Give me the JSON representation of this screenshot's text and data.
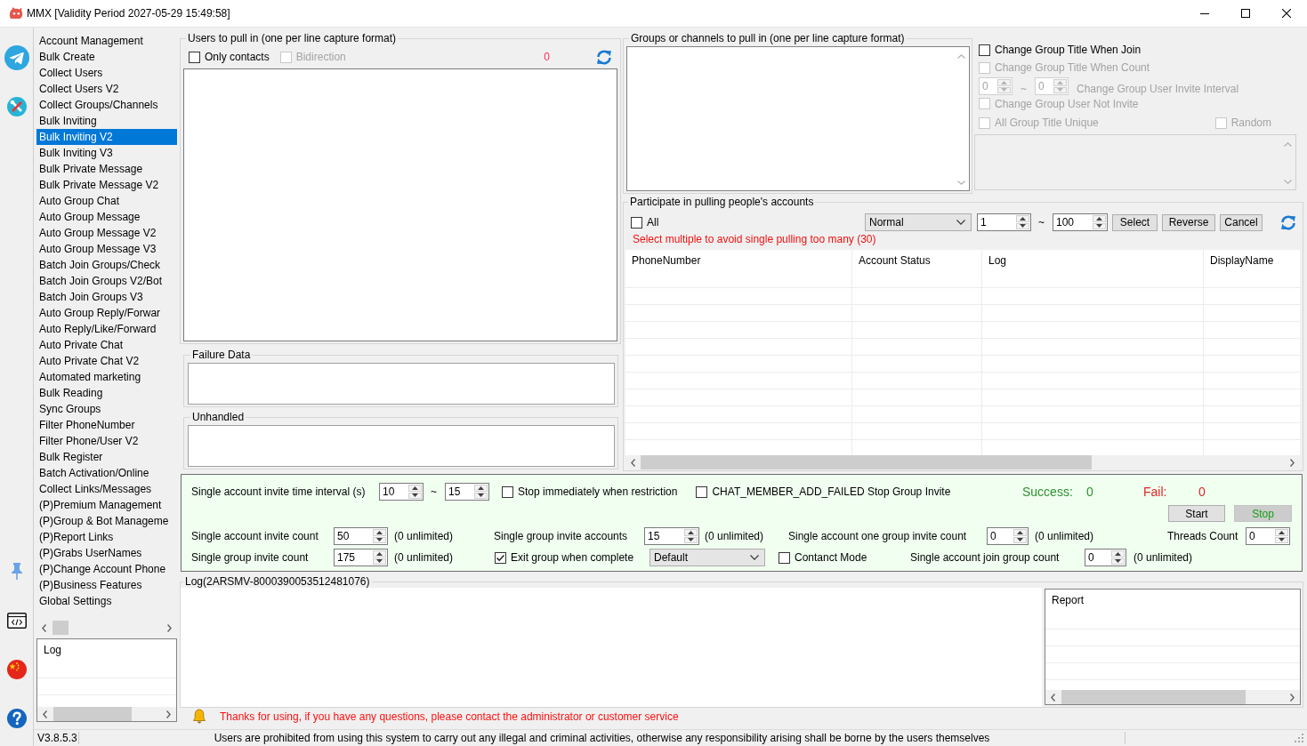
{
  "window": {
    "title": "MMX [Validity Period 2027-05-29 15:49:58]"
  },
  "sidebar": {
    "items": [
      {
        "label": "Account Management",
        "selected": false
      },
      {
        "label": "Bulk Create",
        "selected": false
      },
      {
        "label": "Collect Users",
        "selected": false
      },
      {
        "label": "Collect Users V2",
        "selected": false
      },
      {
        "label": "Collect Groups/Channels",
        "selected": false
      },
      {
        "label": "Bulk Inviting",
        "selected": false
      },
      {
        "label": "Bulk Inviting V2",
        "selected": true
      },
      {
        "label": "Bulk Inviting V3",
        "selected": false
      },
      {
        "label": "Bulk Private Message",
        "selected": false
      },
      {
        "label": "Bulk Private Message V2",
        "selected": false
      },
      {
        "label": "Auto Group Chat",
        "selected": false
      },
      {
        "label": "Auto Group Message",
        "selected": false
      },
      {
        "label": "Auto Group Message V2",
        "selected": false
      },
      {
        "label": "Auto Group Message V3",
        "selected": false
      },
      {
        "label": "Batch Join Groups/Check",
        "selected": false
      },
      {
        "label": "Batch Join Groups V2/Bot",
        "selected": false
      },
      {
        "label": "Batch Join Groups V3",
        "selected": false
      },
      {
        "label": "Auto Group Reply/Forwar",
        "selected": false
      },
      {
        "label": "Auto Reply/Like/Forward",
        "selected": false
      },
      {
        "label": "Auto Private Chat",
        "selected": false
      },
      {
        "label": "Auto Private Chat V2",
        "selected": false
      },
      {
        "label": "Automated marketing",
        "selected": false
      },
      {
        "label": "Bulk Reading",
        "selected": false
      },
      {
        "label": "Sync Groups",
        "selected": false
      },
      {
        "label": "Filter PhoneNumber",
        "selected": false
      },
      {
        "label": "Filter Phone/User V2",
        "selected": false
      },
      {
        "label": "Bulk Register",
        "selected": false
      },
      {
        "label": "Batch Activation/Online",
        "selected": false
      },
      {
        "label": "Collect Links/Messages",
        "selected": false
      },
      {
        "label": "(P)Premium Management",
        "selected": false
      },
      {
        "label": "(P)Group & Bot Manageme",
        "selected": false
      },
      {
        "label": "(P)Report Links",
        "selected": false
      },
      {
        "label": "(P)Grabs UserNames",
        "selected": false
      },
      {
        "label": "(P)Change Account Phone",
        "selected": false
      },
      {
        "label": "(P)Business Features",
        "selected": false
      },
      {
        "label": "Global Settings",
        "selected": false
      }
    ]
  },
  "sidebar_log": {
    "header": "Log"
  },
  "users_panel": {
    "title": "Users to pull in (one per line capture format)",
    "only_contacts": {
      "label": "Only contacts",
      "checked": false,
      "disabled": false
    },
    "bidirection": {
      "label": "Bidirection",
      "checked": false,
      "disabled": true
    },
    "count": "0"
  },
  "failure_data": {
    "title": "Failure Data"
  },
  "unhandled": {
    "title": "Unhandled"
  },
  "groups_panel": {
    "title": "Groups or channels to pull in (one per line capture format)"
  },
  "group_options": {
    "items": [
      {
        "kind": "checkbox",
        "label": "Change Group Title When Join",
        "checked": false,
        "disabled": false
      },
      {
        "kind": "checkbox",
        "label": "Change Group Title When Count",
        "checked": false,
        "disabled": true
      },
      {
        "kind": "range",
        "from": "0",
        "separator": "~",
        "to": "0",
        "label": "Change Group User Invite Interval",
        "disabled": true
      },
      {
        "kind": "checkbox",
        "label": "Change Group User Not Invite",
        "checked": false,
        "disabled": true
      },
      {
        "kind": "checkbox_pair",
        "left": {
          "label": "All Group Title Unique",
          "checked": false,
          "disabled": true
        },
        "right": {
          "label": "Random",
          "checked": false,
          "disabled": true
        }
      }
    ],
    "title_list": {
      "disabled": true
    }
  },
  "accounts_panel": {
    "title": "Participate in pulling people's accounts",
    "select_all": {
      "label": "All",
      "checked": false
    },
    "mode": "Normal",
    "from": "1",
    "separator": "~",
    "to": "100",
    "buttons": [
      "Select",
      "Reverse",
      "Cancel"
    ],
    "warning": "Select multiple to avoid single pulling too many (30)",
    "table": {
      "columns": [
        "PhoneNumber",
        "Account Status",
        "Log",
        "DisplayName"
      ]
    }
  },
  "invite_settings": {
    "interval": {
      "label": "Single account invite time interval (s)",
      "from": "10",
      "separator": "~",
      "to": "15"
    },
    "stop_on_restriction": {
      "label": "Stop immediately when restriction",
      "checked": false
    },
    "stop_on_add_failed": {
      "label": "CHAT_MEMBER_ADD_FAILED Stop Group Invite",
      "checked": false
    },
    "success": {
      "label": "Success:",
      "value": "0"
    },
    "fail": {
      "label": "Fail:",
      "value": "0"
    },
    "buttons": [
      {
        "label": "Start",
        "kind": "default"
      },
      {
        "label": "Stop",
        "kind": "highlighted"
      }
    ],
    "account_invite_count": {
      "label": "Single account invite count",
      "value": "50",
      "hint": "(0 unlimited)"
    },
    "group_invite_accounts": {
      "label": "Single group invite accounts",
      "value": "15",
      "hint": "(0 unlimited)"
    },
    "account_one_group_invite_count": {
      "label": "Single account one group invite count",
      "value": "0",
      "hint": "(0 unlimited)"
    },
    "threads_count": {
      "label": "Threads Count",
      "value": "0"
    },
    "group_invite_count": {
      "label": "Single group invite count",
      "value": "175",
      "hint": "(0 unlimited)"
    },
    "exit_group": {
      "label": "Exit group when complete",
      "checked": true
    },
    "exit_mode": "Default",
    "contact_mode": {
      "label": "Contanct Mode",
      "checked": false
    },
    "account_join_group_count": {
      "label": "Single account join group count",
      "value": "0",
      "hint": "(0 unlimited)"
    }
  },
  "log_section": {
    "title": "Log(2ARSMV-8000390053512481076)"
  },
  "report": {
    "header": "Report"
  },
  "notice": "Thanks for using, if you have any questions, please contact the administrator or customer service",
  "status_bar": {
    "version": "V3.8.5.3",
    "message": "Users are prohibited from using this system to carry out any illegal and criminal activities, otherwise any responsibility arising shall be borne by the users themselves"
  }
}
